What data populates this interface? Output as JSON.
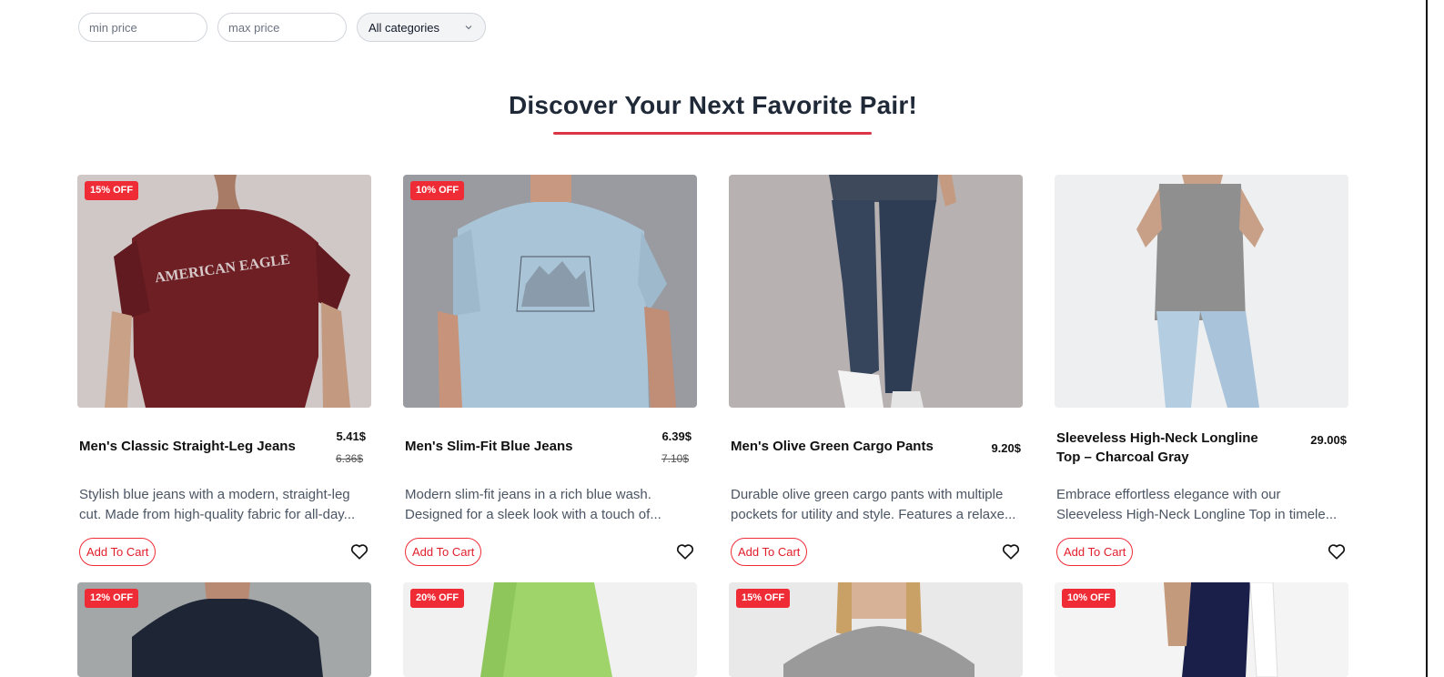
{
  "filters": {
    "min_placeholder": "min price",
    "max_placeholder": "max price",
    "category_selected": "All categories"
  },
  "heading": "Discover Your Next Favorite Pair!",
  "colors": {
    "accent": "#dc3545",
    "badge": "#ef2b36"
  },
  "buttons": {
    "add_to_cart": "Add To Cart"
  },
  "products": [
    {
      "badge": "15% OFF",
      "title": "Men's Classic Straight-Leg Jeans",
      "price": "5.41$",
      "old_price": "6.36$",
      "description": "Stylish blue jeans with a modern, straight-leg cut. Made from high-quality fabric for all-day...",
      "icon": "heart-icon"
    },
    {
      "badge": "10% OFF",
      "title": "Men's Slim-Fit Blue Jeans",
      "price": "6.39$",
      "old_price": "7.10$",
      "description": "Modern slim-fit jeans in a rich blue wash. Designed for a sleek look with a touch of...",
      "icon": "heart-icon"
    },
    {
      "badge": "",
      "title": "Men's Olive Green Cargo Pants",
      "price": "9.20$",
      "old_price": "",
      "description": "Durable olive green cargo pants with multiple pockets for utility and style. Features a relaxe...",
      "icon": "heart-icon"
    },
    {
      "badge": "",
      "title": "Sleeveless High-Neck Longline Top – Charcoal Gray",
      "price": "29.00$",
      "old_price": "",
      "description": "Embrace effortless elegance with our Sleeveless High-Neck Longline Top in timele...",
      "icon": "heart-icon"
    },
    {
      "badge": "12% OFF"
    },
    {
      "badge": "20% OFF"
    },
    {
      "badge": "15% OFF"
    },
    {
      "badge": "10% OFF"
    }
  ]
}
